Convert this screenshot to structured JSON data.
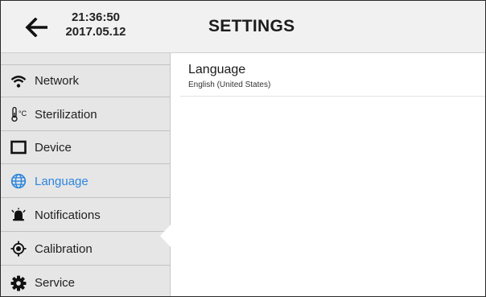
{
  "header": {
    "time": "21:36:50",
    "date": "2017.05.12",
    "title": "SETTINGS"
  },
  "sidebar": {
    "items": [
      {
        "label": "Network",
        "icon": "wifi-icon"
      },
      {
        "label": "Sterilization",
        "icon": "thermometer-icon"
      },
      {
        "label": "Device",
        "icon": "device-icon"
      },
      {
        "label": "Language",
        "icon": "globe-icon",
        "active": true
      },
      {
        "label": "Notifications",
        "icon": "alarm-bell-icon"
      },
      {
        "label": "Calibration",
        "icon": "target-icon"
      },
      {
        "label": "Service",
        "icon": "gear-icon"
      }
    ]
  },
  "main": {
    "setting": {
      "title": "Language",
      "value": "English (United States)"
    }
  },
  "colors": {
    "accent": "#2e86de",
    "sidebar_bg": "#e6e6e6",
    "topbar_bg": "#f1f1f1"
  }
}
